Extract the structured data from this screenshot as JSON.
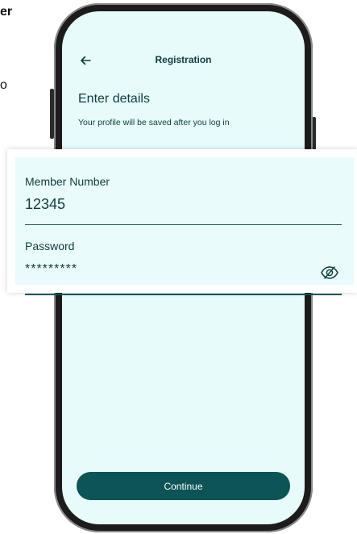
{
  "background": {
    "fragment_bold": "er",
    "fragment_plain": "o"
  },
  "app": {
    "header_title": "Registration",
    "screen_title": "Enter details",
    "screen_subtitle": "Your profile will be saved after you log in",
    "continue_label": "Continue"
  },
  "form": {
    "member_number_label": "Member Number",
    "member_number_value": "12345",
    "password_label": "Password",
    "password_value": "*********"
  },
  "icons": {
    "back": "arrow-left-icon",
    "password_visibility": "eye-slash-icon"
  },
  "colors": {
    "screen_bg": "#e6fbfa",
    "primary": "#0d5457",
    "text": "#0f3d3e"
  }
}
